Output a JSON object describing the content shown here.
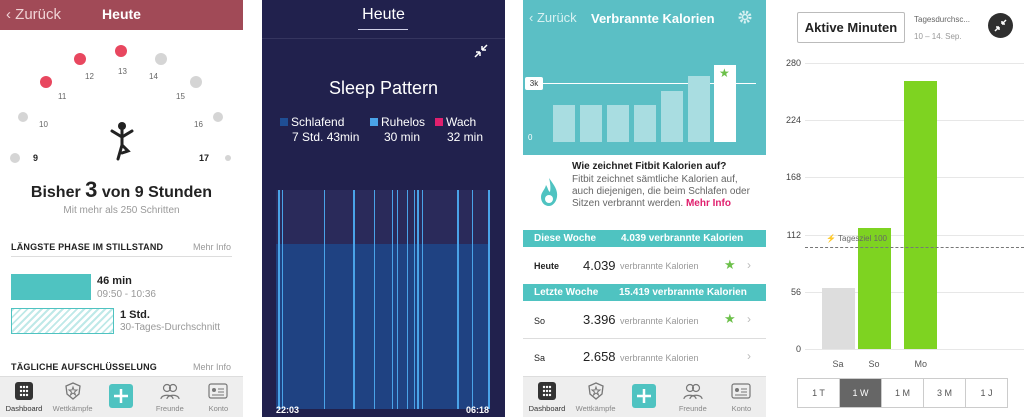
{
  "panel1": {
    "back_label": "Zurück",
    "title": "Heute",
    "hours": [
      "9",
      "10",
      "11",
      "12",
      "13",
      "14",
      "15",
      "16",
      "17"
    ],
    "big_prefix": "Bisher ",
    "big_num": "3",
    "big_suffix": " von 9 Stunden",
    "subtitle": "Mit mehr als 250 Schritten",
    "section1": "LÄNGSTE PHASE IM STILLSTAND",
    "more1": "Mehr Info",
    "item1_value": "46 min",
    "item1_time": "09:50 - 10:36",
    "item2_value": "1 Std.",
    "item2_time": "30-Tages-Durchschnitt",
    "section2": "TÄGLICHE AUFSCHLÜSSELUNG",
    "more2": "Mehr Info",
    "colors": {
      "header": "#a14a57",
      "accent": "#4fc3c1",
      "active_dot": "#e8475f"
    }
  },
  "tabs": [
    "Dashboard",
    "Wettkämpfe",
    "",
    "Freunde",
    "Konto"
  ],
  "panel2": {
    "title": "Heute",
    "chart_title": "Sleep Pattern",
    "legend": [
      {
        "name": "Schlafend",
        "value": "7 Std. 43min",
        "color": "#1f4e94"
      },
      {
        "name": "Ruhelos",
        "value": "30 min",
        "color": "#4aa3e8"
      },
      {
        "name": "Wach",
        "value": "32 min",
        "color": "#e0206e"
      }
    ],
    "start_time": "22:03",
    "end_time": "06:18"
  },
  "panel3": {
    "back_label": "Zurück",
    "title": "Verbrannte Kalorien",
    "chart_label_3k": "3k",
    "chart_label_0": "0",
    "info_title": "Wie zeichnet Fitbit Kalorien auf?",
    "info_body": "Fitbit zeichnet sämtliche Kalorien auf, auch diejenigen, die beim Schlafen oder Sitzen verbrannt werden.",
    "info_link": "Mehr Info",
    "week1_label": "Diese Woche",
    "week1_total": "4.039 verbrannte Kalorien",
    "week2_label": "Letzte Woche",
    "week2_total": "15.419 verbrannte Kalorien",
    "rows": [
      {
        "day": "Heute",
        "value": "4.039",
        "unit": "verbrannte Kalorien"
      },
      {
        "day": "So",
        "value": "3.396",
        "unit": "verbrannte Kalorien"
      },
      {
        "day": "Sa",
        "value": "2.658",
        "unit": "verbrannte Kalorien"
      }
    ]
  },
  "panel4": {
    "button": "Aktive Minuten",
    "tagesziel_heading": "Tagesdurchsc...",
    "date_range": "10 – 14. Sep.",
    "goal_label": "Tagesziel 100",
    "segments": [
      "1 T",
      "1 W",
      "1 M",
      "3 M",
      "1 J"
    ],
    "selected_segment": "1 W"
  },
  "chart_data": {
    "type": "bar",
    "categories": [
      "Sa",
      "So",
      "Mo"
    ],
    "values": [
      60,
      118,
      262
    ],
    "ylim": [
      0,
      280
    ],
    "yticks": [
      0,
      56,
      112,
      168,
      224,
      280
    ],
    "goal": 100,
    "colors": [
      "#dddddd",
      "#7ed321",
      "#7ed321"
    ]
  }
}
